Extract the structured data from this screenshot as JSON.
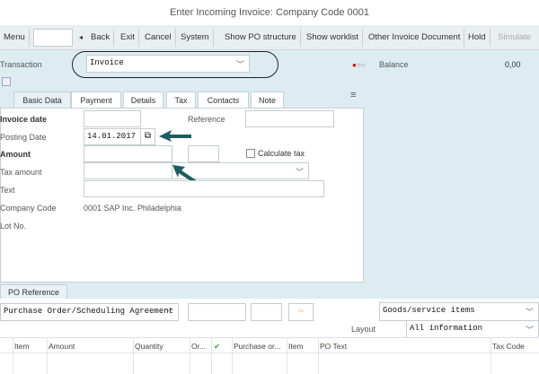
{
  "window": {
    "title": "Enter Incoming Invoice: Company Code 0001"
  },
  "toolbar": {
    "menu": "Menu",
    "back": "Back",
    "exit": "Exit",
    "cancel": "Cancel",
    "system": "System",
    "show_po_structure": "Show PO structure",
    "show_worklist": "Show worklist",
    "other_invoice": "Other Invoice Document",
    "hold": "Hold",
    "simulate": "Simulate"
  },
  "header": {
    "transaction_label": "Transaction",
    "transaction_value": "Invoice",
    "balance_label": "Balance",
    "balance_value": "0,00"
  },
  "tabs": [
    "Basic Data",
    "Payment",
    "Details",
    "Tax",
    "Contacts",
    "Note"
  ],
  "form": {
    "invoice_date_label": "Invoice date",
    "reference_label": "Reference",
    "posting_date_label": "Posting Date",
    "posting_date_value": "14.01.2017",
    "amount_label": "Amount",
    "calculate_tax_label": "Calculate tax",
    "tax_amount_label": "Tax amount",
    "text_label": "Text",
    "company_code_label": "Company Code",
    "company_code_value": "0001 SAP Inc. Philadelphia",
    "lot_no_label": "Lot No."
  },
  "po": {
    "tab": "PO Reference",
    "doc_type": "Purchase Order/Scheduling Agreement",
    "items_select": "Goods/service items",
    "layout_label": "Layout",
    "layout_value": "All information"
  },
  "table": {
    "columns": [
      "Item",
      "Amount",
      "Quantity",
      "Or...",
      "Purchase or...",
      "Item",
      "PO Text",
      "Tax Code"
    ]
  }
}
